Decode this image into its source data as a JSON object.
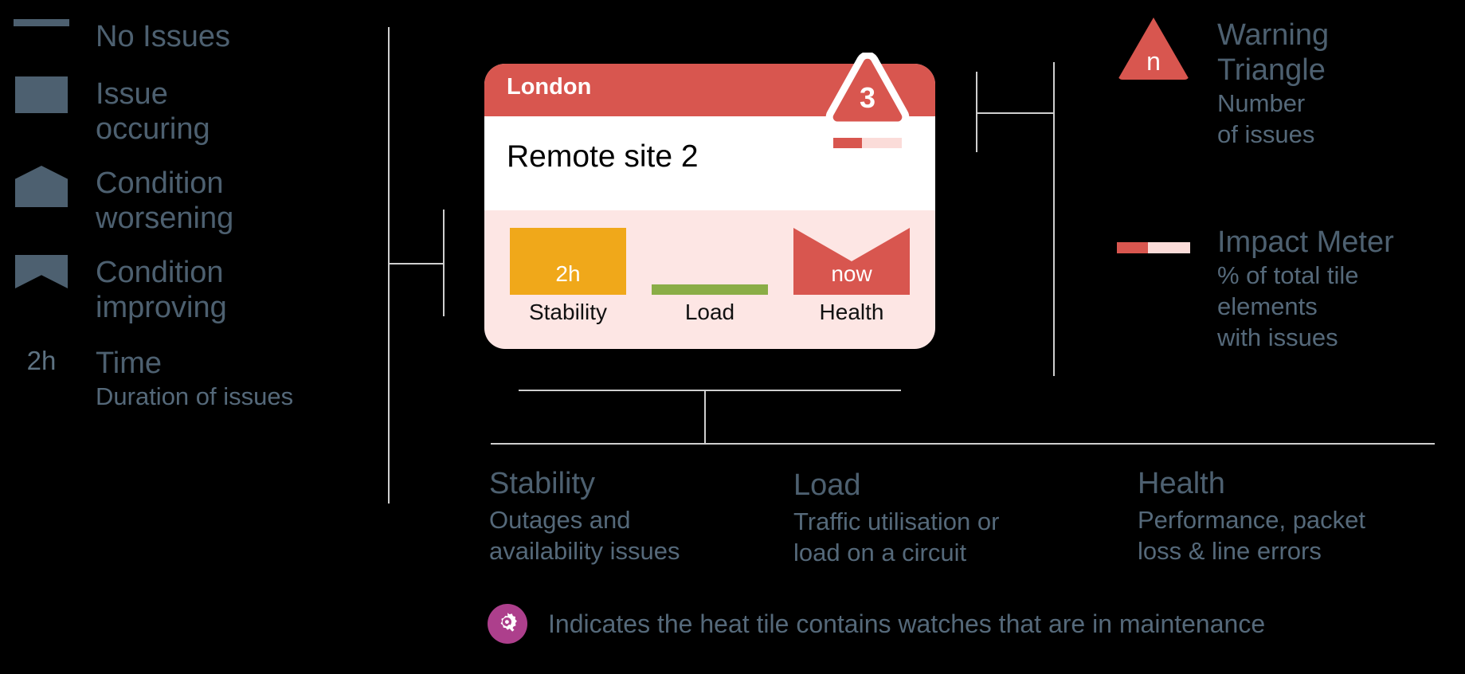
{
  "colors": {
    "background": "#000000",
    "slate": "#4d6070",
    "slate_light": "#55697a",
    "red": "#d8564f",
    "red_pale": "#fde6e4",
    "red_meter_track": "#fbdcd9",
    "amber": "#f0a81a",
    "green": "#8aad46",
    "connector": "#cfcfcf",
    "maintenance_purple": "#ad3f8c",
    "white": "#ffffff"
  },
  "left_legend": {
    "items": [
      {
        "icon": "horizontal-line-icon",
        "label": "No Issues"
      },
      {
        "icon": "filled-square-icon",
        "label": "Issue\noccuring"
      },
      {
        "icon": "pentagon-up-icon",
        "label": "Condition\nworsening"
      },
      {
        "icon": "chevron-notch-icon",
        "label": "Condition\nimproving"
      }
    ],
    "time_item": {
      "swatch_text": "2h",
      "title": "Time",
      "subtitle": "Duration of issues"
    }
  },
  "tile_card": {
    "header_title": "London",
    "site_name": "Remote site 2",
    "warning_triangle": {
      "icon": "warning-triangle-icon",
      "count": "3"
    },
    "impact_meter": {
      "filled_percent": 42
    },
    "metrics": [
      {
        "name": "Stability",
        "label": "Stability",
        "value": "2h",
        "shape": "square",
        "color": "#f0a81a"
      },
      {
        "name": "Load",
        "label": "Load",
        "value": "",
        "shape": "line",
        "color": "#8aad46"
      },
      {
        "name": "Health",
        "label": "Health",
        "value": "now",
        "shape": "chevron-improving",
        "color": "#d8564f"
      }
    ]
  },
  "right_legend": {
    "warning": {
      "swatch_label": "n",
      "title": "Warning\nTriangle",
      "subtitle": "Number\nof issues"
    },
    "impact": {
      "title": "Impact Meter",
      "subtitle": "% of total tile\nelements\nwith issues",
      "filled_percent": 42
    }
  },
  "metric_descriptions": [
    {
      "title": "Stability",
      "body": "Outages and\navailability issues"
    },
    {
      "title": "Load",
      "body": "Traffic utilisation or\nload on a circuit"
    },
    {
      "title": "Health",
      "body": "Performance, packet\nloss & line errors"
    }
  ],
  "maintenance_note": {
    "icon": "maintenance-gear-icon",
    "text": "Indicates the heat tile contains watches that are in maintenance"
  }
}
